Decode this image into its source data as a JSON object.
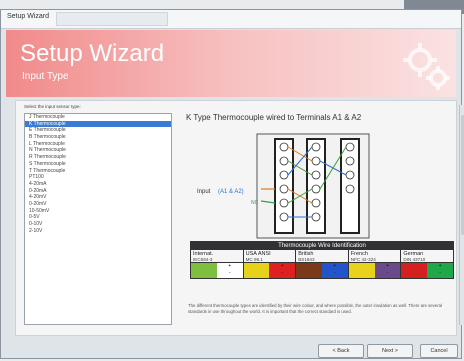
{
  "window": {
    "title": "Setup Wizard"
  },
  "banner": {
    "title": "Setup Wizard",
    "subtitle": "Input Type"
  },
  "sensor_list": {
    "label": "Select the input sensor type:",
    "items": [
      "J Thermocouple",
      "K Thermocouple",
      "E Thermocouple",
      "B Thermocouple",
      "L Thermocouple",
      "N Thermocouple",
      "R Thermocouple",
      "S Thermocouple",
      "T Thermocouple",
      "PT100",
      "4-20mA",
      "0-20mA",
      "4-20mV",
      "0-20mV",
      "10-50mV",
      "0-5V",
      "0-10V",
      "2-10V"
    ],
    "selected_index": 1
  },
  "main": {
    "heading": "K Type Thermocouple wired to Terminals A1 & A2"
  },
  "diagram": {
    "input_label": "Input",
    "terminals": "(A1 & A2)",
    "note": "NC"
  },
  "wire_table": {
    "title": "Thermocouple Wire Identification",
    "columns": [
      {
        "name": "Internat.",
        "standard": "IEC584-3",
        "left": "#7fbf3f",
        "right": "#ffffff",
        "plus": "+",
        "minus": "-"
      },
      {
        "name": "USA ANSI",
        "standard": "MC 96.1",
        "left": "#e6d21a",
        "right": "#e02020",
        "plus": "+",
        "minus": "-"
      },
      {
        "name": "British",
        "standard": "BS1843",
        "left": "#7a3a1a",
        "right": "#2255cc",
        "plus": "+",
        "minus": "-"
      },
      {
        "name": "French",
        "standard": "NFC 42-324",
        "left": "#e8d21c",
        "right": "#6a4a8a",
        "plus": "+",
        "minus": "-"
      },
      {
        "name": "German",
        "standard": "DIN 43710",
        "left": "#d42020",
        "right": "#1fa84a",
        "plus": "+",
        "minus": "-"
      }
    ]
  },
  "description": "The different thermocouple types are identified by their wire colour, and where possible, the outer insulation as well. There are several standards in use throughout the world. It is important that the correct standard is used.",
  "buttons": {
    "back": "< Back",
    "next": "Next >",
    "cancel": "Cancel"
  }
}
